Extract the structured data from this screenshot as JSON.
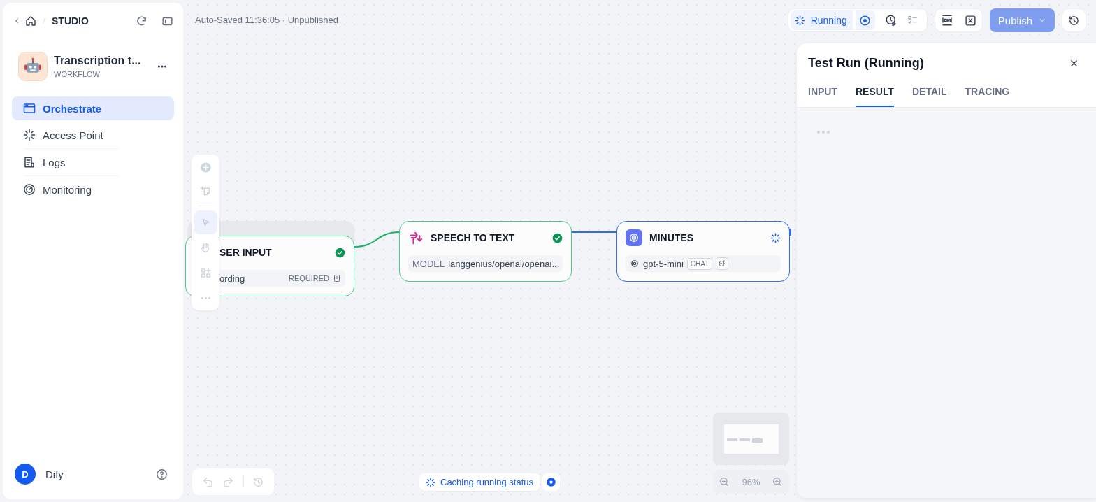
{
  "header": {
    "breadcrumb": "STUDIO"
  },
  "app": {
    "name": "Transcription t...",
    "type": "WORKFLOW"
  },
  "nav": [
    {
      "kind": "orchestrate",
      "label": "Orchestrate",
      "selected": true
    },
    {
      "kind": "access",
      "label": "Access Point",
      "selected": false
    },
    {
      "kind": "logs",
      "label": "Logs",
      "selected": false
    },
    {
      "kind": "monitoring",
      "label": "Monitoring",
      "selected": false
    }
  ],
  "user": {
    "initial": "D",
    "name": "Dify"
  },
  "status_line": "Auto-Saved 11:36:05 · Unpublished",
  "run_toolbar": {
    "status": "Running"
  },
  "publish": {
    "label": "Publish",
    "disabled": true
  },
  "canvas_tools": [
    {
      "kind": "add",
      "selected": false
    },
    {
      "kind": "note",
      "selected": false
    },
    {
      "kind": "pointer",
      "selected": true
    },
    {
      "kind": "hand",
      "selected": false
    },
    {
      "kind": "organize",
      "selected": false
    },
    {
      "kind": "more",
      "selected": false
    }
  ],
  "nodes": [
    {
      "kind": "start",
      "title": "SER INPUT",
      "running": false,
      "field": "ording",
      "tag": "REQUIRED"
    },
    {
      "kind": "stt",
      "title": "SPEECH TO TEXT",
      "running": false,
      "label": "MODEL",
      "model": "langgenius/openai/openai..."
    },
    {
      "kind": "llm",
      "title": "MINUTES",
      "running": true,
      "model": "gpt-5-mini",
      "mode": "CHAT"
    }
  ],
  "caching": {
    "text": "Caching running status"
  },
  "zoom": "96%",
  "panel": {
    "title": "Test Run (Running)",
    "tabs": [
      {
        "label": "INPUT",
        "selected": false
      },
      {
        "label": "RESULT",
        "selected": true
      },
      {
        "label": "DETAIL",
        "selected": false
      },
      {
        "label": "TRACING",
        "selected": false
      }
    ]
  }
}
